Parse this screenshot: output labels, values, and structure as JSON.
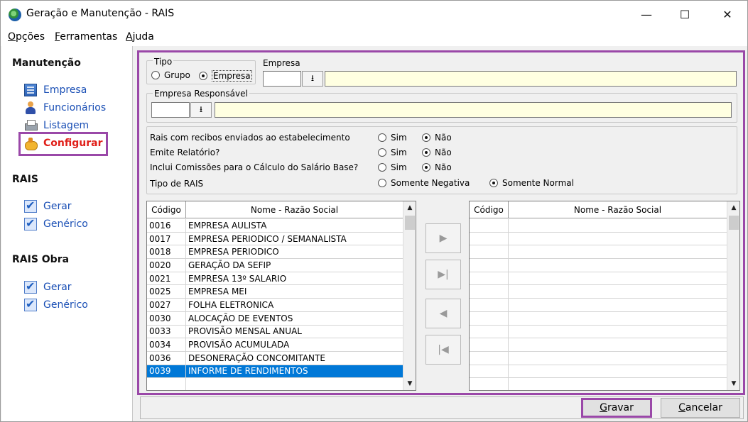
{
  "window": {
    "title": "Geração e Manutenção - RAIS",
    "minimize": "—",
    "maximize": "☐",
    "close": "✕"
  },
  "menu": [
    {
      "first": "O",
      "rest": "pções"
    },
    {
      "first": "F",
      "rest": "erramentas"
    },
    {
      "first": "A",
      "rest": "juda"
    }
  ],
  "sidebar": {
    "manutencao_title": "Manutenção",
    "manutencao": [
      "Empresa",
      "Funcionários",
      "Listagem",
      "Configurar"
    ],
    "rais_title": "RAIS",
    "rais": [
      "Gerar",
      "Genérico"
    ],
    "rais_obra_title": "RAIS Obra",
    "rais_obra": [
      "Gerar",
      "Genérico"
    ]
  },
  "form": {
    "tipo_label": "Tipo",
    "tipo_grupo": "Grupo",
    "tipo_empresa": "Empresa",
    "tipo_selected": "Empresa",
    "empresa_label": "Empresa",
    "empresa_code": "",
    "empresa_name": "",
    "resp_label": "Empresa Responsável",
    "resp_code": "",
    "resp_name": "",
    "lookup_glyph": "⭳",
    "options": [
      {
        "label": "Rais com recibos enviados ao estabelecimento",
        "a": "Sim",
        "b": "Não",
        "selected": "Não"
      },
      {
        "label": "Emite Relatório?",
        "a": "Sim",
        "b": "Não",
        "selected": "Não"
      },
      {
        "label": "Inclui Comissões para o Cálculo do Salário Base?",
        "a": "Sim",
        "b": "Não",
        "selected": "Não"
      },
      {
        "label": "Tipo de RAIS",
        "a": "Somente Negativa",
        "b": "Somente Normal",
        "selected": "Somente Normal"
      }
    ]
  },
  "left_grid": {
    "headers": [
      "Código",
      "Nome - Razão Social"
    ],
    "rows": [
      [
        "0016",
        "EMPRESA AULISTA"
      ],
      [
        "0017",
        "EMPRESA PERIODICO / SEMANALISTA"
      ],
      [
        "0018",
        "EMPRESA PERIODICO"
      ],
      [
        "0020",
        "GERAÇÃO DA SEFIP"
      ],
      [
        "0021",
        "EMPRESA 13º SALARIO"
      ],
      [
        "0025",
        "EMPRESA MEI"
      ],
      [
        "0027",
        "FOLHA ELETRONICA"
      ],
      [
        "0030",
        "ALOCAÇÃO DE EVENTOS"
      ],
      [
        "0033",
        "PROVISÃO MENSAL ANUAL"
      ],
      [
        "0034",
        "PROVISÃO ACUMULADA"
      ],
      [
        "0036",
        "DESONERAÇÃO CONCOMITANTE"
      ],
      [
        "0039",
        "INFORME DE RENDIMENTOS"
      ]
    ],
    "selected_row": 11
  },
  "right_grid": {
    "headers": [
      "Código",
      "Nome - Razão Social"
    ],
    "rows": []
  },
  "move_buttons": [
    "▶",
    "▶|",
    "◀",
    "|◀"
  ],
  "buttons": {
    "save_first": "G",
    "save_rest": "ravar",
    "cancel_first": "C",
    "cancel_rest": "ancelar"
  },
  "colors": {
    "highlight": "#9a48a8",
    "selection": "#0078d7",
    "link": "#1a4fb5",
    "configurar": "#e0201a",
    "input_yellow": "#ffffe1"
  }
}
